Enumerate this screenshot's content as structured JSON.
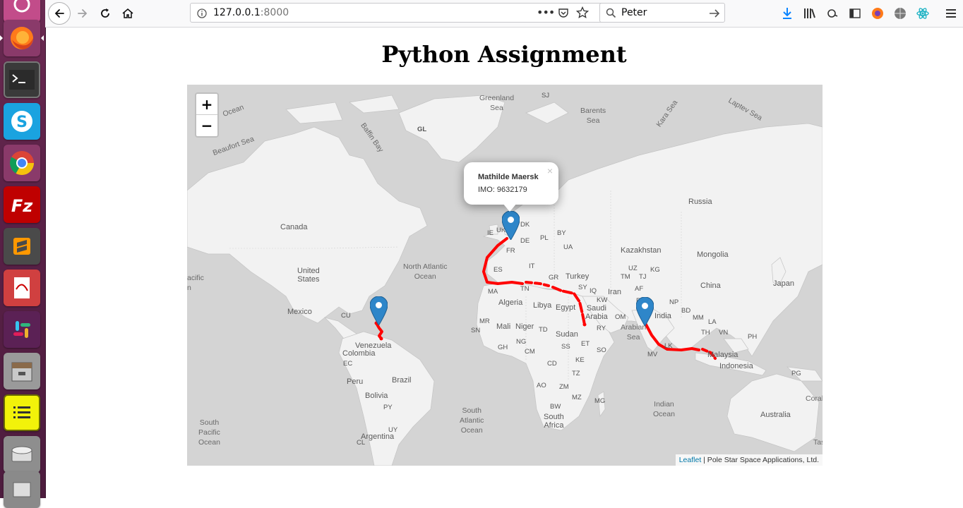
{
  "browser": {
    "url_host": "127.0.0.1",
    "url_port": ":8000",
    "search_text": "Peter"
  },
  "page": {
    "title": "Python Assignment"
  },
  "map": {
    "zoom_in": "+",
    "zoom_out": "−",
    "popup": {
      "close": "×",
      "name": "Mathilde Maersk",
      "imo": "IMO: 9632179"
    },
    "attribution_link": "Leaflet",
    "attribution_rest": " | Pole Star Space Applications, Ltd.",
    "route_color": "#ff0000",
    "marker_color": "#2e86c9",
    "labels": {
      "greenland_sea": "Greenland\nSea",
      "sj": "SJ",
      "barents_sea": "Barents\nSea",
      "kara_sea": "Kara Sea",
      "laptev_sea": "Laptev Sea",
      "gl": "GL",
      "baffin_bay": "Baffin Bay",
      "beaufort_sea": "Beaufort Sea",
      "ocean_top": "Ocean",
      "canada": "Canada",
      "russia": "Russia",
      "united_states": "United\nStates",
      "north_atlantic": "North Atlantic\nOcean",
      "pacific_left": "acific\nn",
      "mexico": "Mexico",
      "cu": "CU",
      "venezuela": "Venezuela",
      "colombia": "Colombia",
      "ec": "EC",
      "peru": "Peru",
      "brazil": "Brazil",
      "bolivia": "Bolivia",
      "py": "PY",
      "uy": "UY",
      "argentina": "Argentina",
      "cl": "CL",
      "south_pacific": "South\nPacific\nOcean",
      "south_atlantic": "South\nAtlantic\nOcean",
      "indian_ocean": "Indian\nOcean",
      "arabian_sea": "Arabian\nSea",
      "ie": "IE",
      "uk": "UK",
      "dk": "DK",
      "de": "DE",
      "pl": "PL",
      "by": "BY",
      "ua": "UA",
      "fr": "FR",
      "es": "ES",
      "it": "IT",
      "gr": "GR",
      "turkey": "Turkey",
      "sy": "SY",
      "iq": "IQ",
      "ir": "Iran",
      "kw": "KW",
      "tn": "TN",
      "ma": "MA",
      "algeria": "Algeria",
      "libya": "Libya",
      "egypt": "Egypt",
      "saudi": "Saudi\nArabia",
      "ry": "RY",
      "om": "OM",
      "mr": "MR",
      "mali": "Mali",
      "niger": "Niger",
      "td": "TD",
      "sudan": "Sudan",
      "sn": "SN",
      "gh": "GH",
      "ng": "NG",
      "cm": "CM",
      "ss": "SS",
      "et": "ET",
      "so": "SO",
      "cd": "CD",
      "ke": "KE",
      "tz": "TZ",
      "ao": "AO",
      "zm": "ZM",
      "mz": "MZ",
      "bw": "BW",
      "mg": "MG",
      "south_africa": "South\nAfrica",
      "kazakhstan": "Kazakhstan",
      "mongolia": "Mongolia",
      "uz": "UZ",
      "kg": "KG",
      "tm": "TM",
      "tj": "TJ",
      "af": "AF",
      "pk": "PK",
      "china": "China",
      "japan": "Japan",
      "india": "India",
      "np": "NP",
      "bd": "BD",
      "mm": "MM",
      "la": "LA",
      "th": "TH",
      "vn": "VN",
      "ph": "PH",
      "lk": "LK",
      "mv": "MV",
      "malaysia": "Malaysia",
      "indonesia": "Indonesia",
      "pg": "PG",
      "australia": "Australia",
      "coral": "Coral",
      "tas": "Tas"
    }
  }
}
